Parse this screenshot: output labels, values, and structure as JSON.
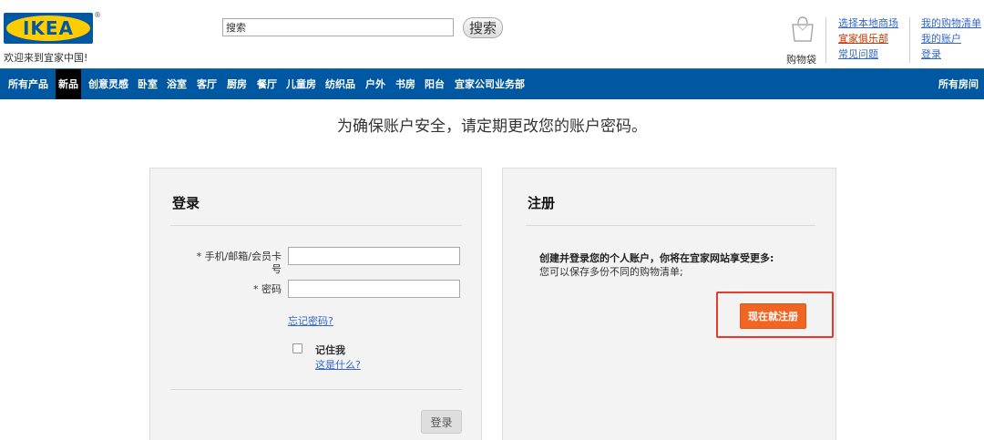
{
  "brand": {
    "logo_text": "IKEA",
    "registered_mark": "®",
    "welcome": "欢迎来到宜家中国!",
    "colors": {
      "blue": "#0058a3",
      "yellow": "#ffcc00",
      "orange": "#f16522",
      "link": "#3366cc",
      "red_link": "#cc3300"
    }
  },
  "search": {
    "placeholder": "搜索",
    "button_label": "搜索"
  },
  "cart": {
    "label": "购物袋",
    "icon": "shopping-bag-icon"
  },
  "header_links": {
    "col1": [
      "选择本地商场",
      "宜家俱乐部",
      "常见问题"
    ],
    "col2": [
      "我的购物清单",
      "我的账户",
      "登录"
    ]
  },
  "nav": {
    "items": [
      "所有产品",
      "新品",
      "创意灵感",
      "卧室",
      "浴室",
      "客厅",
      "厨房",
      "餐厅",
      "儿童房",
      "纺织品",
      "户外",
      "书房",
      "阳台",
      "宜家公司业务部"
    ],
    "active": "新品",
    "all_rooms": "所有房间"
  },
  "notice": "为确保账户安全，请定期更改您的账户密码。",
  "login": {
    "title": "登录",
    "username_label_line1": "* 手机/邮箱/会员卡",
    "username_label_line2": "号",
    "password_label": "* 密码",
    "username_value": "",
    "password_value": "",
    "forgot": "忘记密码?",
    "remember": "记住我",
    "whats_this": "这是什么?",
    "remember_checked": false,
    "submit": "登录"
  },
  "register": {
    "title": "注册",
    "heading": "创建并登录您的个人账户，你将在宜家网站享受更多:",
    "text": "您可以保存多份不同的购物清单;",
    "button": "现在就注册"
  }
}
